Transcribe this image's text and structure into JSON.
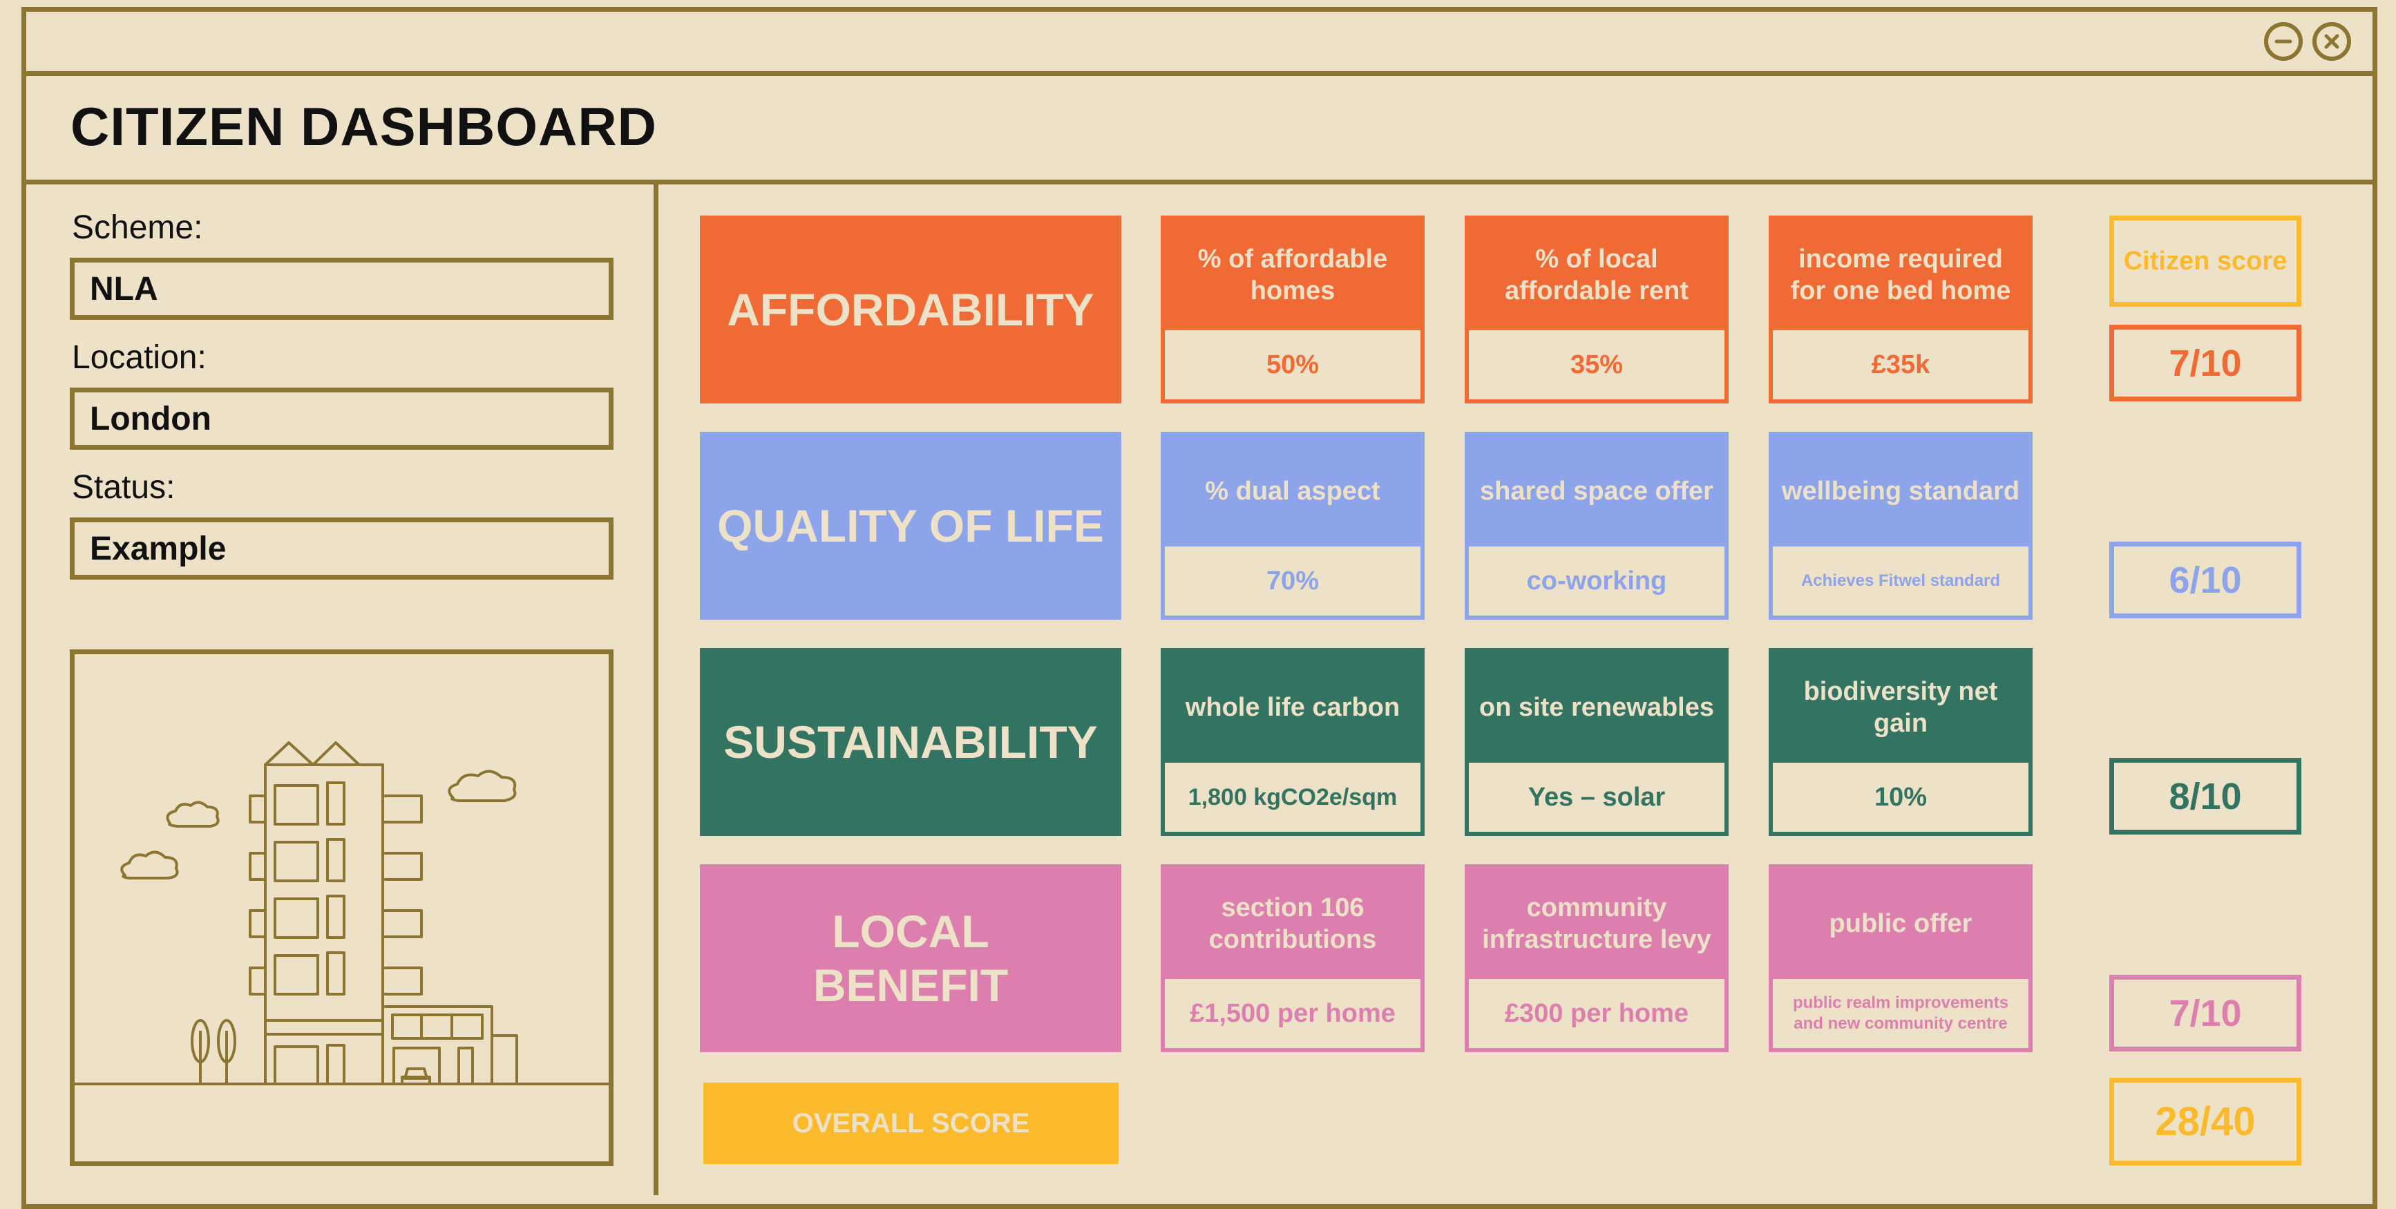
{
  "window": {
    "title": "CITIZEN DASHBOARD",
    "controls": {
      "minimize_icon": "minus-circle-icon",
      "close_icon": "x-circle-icon"
    }
  },
  "sidebar": {
    "scheme_label": "Scheme:",
    "scheme_value": "NLA",
    "location_label": "Location:",
    "location_value": "London",
    "status_label": "Status:",
    "status_value": "Example",
    "illustration_icon": "building-illustration"
  },
  "colors": {
    "background": "#ede1c8",
    "frame": "#8c7530",
    "affordability": "#f06a35",
    "quality_of_life": "#8da3ea",
    "sustainability": "#327361",
    "local_benefit": "#dd7fae",
    "overall": "#fbb92c"
  },
  "categories": [
    {
      "label": "AFFORDABILITY",
      "metrics": [
        {
          "title": "% of affordable homes",
          "value": "50%"
        },
        {
          "title": "% of local affordable rent",
          "value": "35%"
        },
        {
          "title": "income required for one bed home",
          "value": "£35k"
        }
      ],
      "score": "7/10"
    },
    {
      "label": "QUALITY OF LIFE",
      "metrics": [
        {
          "title": "% dual aspect",
          "value": "70%"
        },
        {
          "title": "shared space offer",
          "value": "co-working"
        },
        {
          "title": "wellbeing standard",
          "value": "Achieves Fitwel standard"
        }
      ],
      "score": "6/10"
    },
    {
      "label": "SUSTAINABILITY",
      "metrics": [
        {
          "title": "whole life carbon",
          "value": "1,800 kgCO2e/sqm"
        },
        {
          "title": "on site renewables",
          "value": "Yes – solar"
        },
        {
          "title": "biodiversity net gain",
          "value": "10%"
        }
      ],
      "score": "8/10"
    },
    {
      "label": "LOCAL BENEFIT",
      "metrics": [
        {
          "title": "section 106 contributions",
          "value": "£1,500 per home"
        },
        {
          "title": "community infrastructure levy",
          "value": "£300 per home"
        },
        {
          "title": "public offer",
          "value": "public realm improvements and new community centre"
        }
      ],
      "score": "7/10"
    }
  ],
  "citizen_score_label": "Citizen score",
  "overall": {
    "label": "OVERALL SCORE",
    "score": "28/40"
  }
}
